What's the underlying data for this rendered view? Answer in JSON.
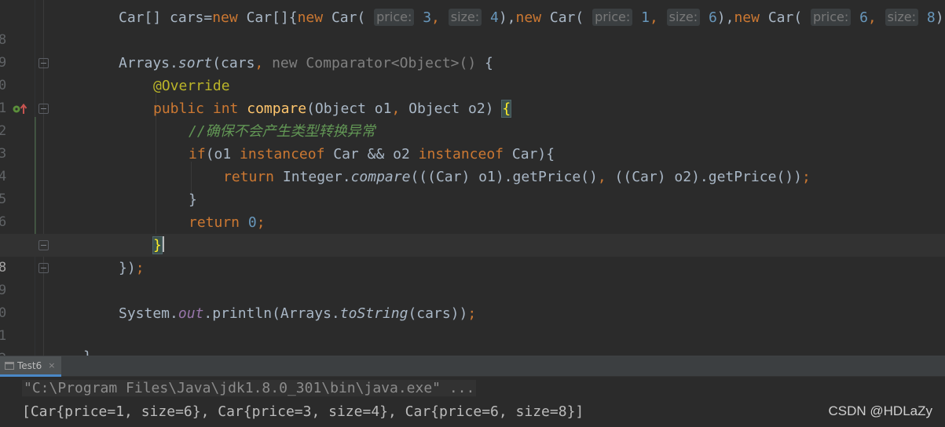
{
  "editor": {
    "line_numbers": [
      "8",
      "9",
      "0",
      "1",
      "2",
      "3",
      "4",
      "5",
      "6",
      "7",
      "8",
      "9",
      "0",
      "1",
      "2"
    ],
    "line_top_partial_number": "8",
    "code": {
      "l18_a": "Car[] cars=",
      "l18_new1": "new",
      "l18_b": " Car[]{",
      "l18_new2": "new",
      "l18_c": " Car(",
      "l18_hint_price1": "price:",
      "l18_v1": "3",
      "l18_comma1": ",",
      "l18_hint_size1": "size:",
      "l18_v2": "4",
      "l18_d": "),",
      "l18_new3": "new",
      "l18_e": " Car(",
      "l18_hint_price2": "price:",
      "l18_v3": "1",
      "l18_comma2": ",",
      "l18_hint_size2": "size:",
      "l18_v4": "6",
      "l18_f": "),",
      "l18_new4": "new",
      "l18_g": " Car(",
      "l18_hint_price3": "price:",
      "l18_v5": "6",
      "l18_comma3": ",",
      "l18_hint_size3": "size:",
      "l18_v6": "8",
      "l18_h": ")}",
      "l18_semi": ";",
      "l20_a": "Arrays.",
      "l20_sort": "sort",
      "l20_b": "(cars",
      "l20_comma": ",",
      "l20_gray": " new Comparator<Object>()",
      "l20_c": " {",
      "l21_override": "@Override",
      "l22_public": "public",
      "l22_sp": " ",
      "l22_int": "int",
      "l22_sp2": " ",
      "l22_compare": "compare",
      "l22_a": "(Object o1",
      "l22_comma": ",",
      "l22_b": " Object o2) ",
      "l22_brace": "{",
      "l23_comment": "//确保不会产生类型转换异常",
      "l24_if": "if",
      "l24_a": "(o1 ",
      "l24_instanceof1": "instanceof",
      "l24_b": " Car && o2 ",
      "l24_instanceof2": "instanceof",
      "l24_c": " Car){",
      "l25_return": "return",
      "l25_a": " Integer.",
      "l25_compare": "compare",
      "l25_b": "(((Car) o1).getPrice()",
      "l25_comma": ",",
      "l25_c": " ((Car) o2).getPrice())",
      "l25_semi": ";",
      "l26_close": "}",
      "l27_return": "return",
      "l27_sp": " ",
      "l27_zero": "0",
      "l27_semi": ";",
      "l28_close": "}",
      "l29_close": "})",
      "l29_semi": ";",
      "l31_a": "System.",
      "l31_out": "out",
      "l31_b": ".println(Arrays.",
      "l31_tostring": "toString",
      "l31_c": "(cars))",
      "l31_semi": ";",
      "l33_close": "}"
    }
  },
  "run_panel": {
    "tab_label": "Test6",
    "tab_close": "×",
    "command_line": "\"C:\\Program Files\\Java\\jdk1.8.0_301\\bin\\java.exe\" ...",
    "output_line": "[Car{price=1, size=6}, Car{price=3, size=4}, Car{price=6, size=8}]"
  },
  "watermark": "CSDN @HDLaZy",
  "colors": {
    "background": "#2b2b2b",
    "keyword": "#cc7832",
    "annotation": "#bbb529",
    "method": "#ffc66d",
    "number": "#6897bb",
    "comment": "#629755",
    "static_field": "#9876aa",
    "text": "#a9b7c6"
  }
}
